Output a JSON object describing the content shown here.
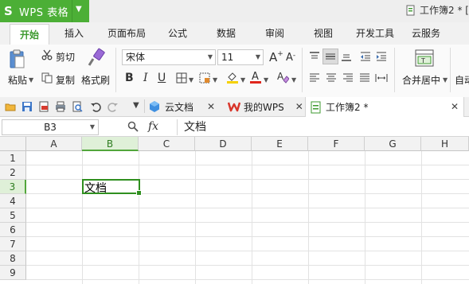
{
  "app": {
    "logo_glyph": "S",
    "name": "WPS 表格",
    "accent_color": "#4caf36",
    "doc_title": "工作簿2 * ["
  },
  "menu_tabs": [
    "开始",
    "插入",
    "页面布局",
    "公式",
    "数据",
    "审阅",
    "视图",
    "开发工具",
    "云服务"
  ],
  "ribbon": {
    "paste": "粘贴",
    "cut": "剪切",
    "copy": "复制",
    "format_painter": "格式刷",
    "font_name": "宋体",
    "font_size": "11",
    "grow_font": "A",
    "shrink_font": "A",
    "bold": "B",
    "italic": "I",
    "underline": "U",
    "merge_center": "合并居中",
    "auto_wrap": "自动"
  },
  "doc_tabs": [
    {
      "label": "云文档",
      "closable": true,
      "active": false
    },
    {
      "label": "我的WPS",
      "closable": true,
      "active": false
    },
    {
      "label": "工作簿2 *",
      "closable": true,
      "active": true
    }
  ],
  "formula_bar": {
    "name_box": "B3",
    "fx": "fx",
    "content": "文档"
  },
  "sheet": {
    "columns": [
      "A",
      "B",
      "C",
      "D",
      "E",
      "F",
      "G",
      "H"
    ],
    "rows": [
      "1",
      "2",
      "3",
      "4",
      "5",
      "6",
      "7",
      "8",
      "9"
    ],
    "selected_cell": "B3",
    "cells": {
      "B3": "文档"
    },
    "selection_color": "#2f8f1f"
  }
}
